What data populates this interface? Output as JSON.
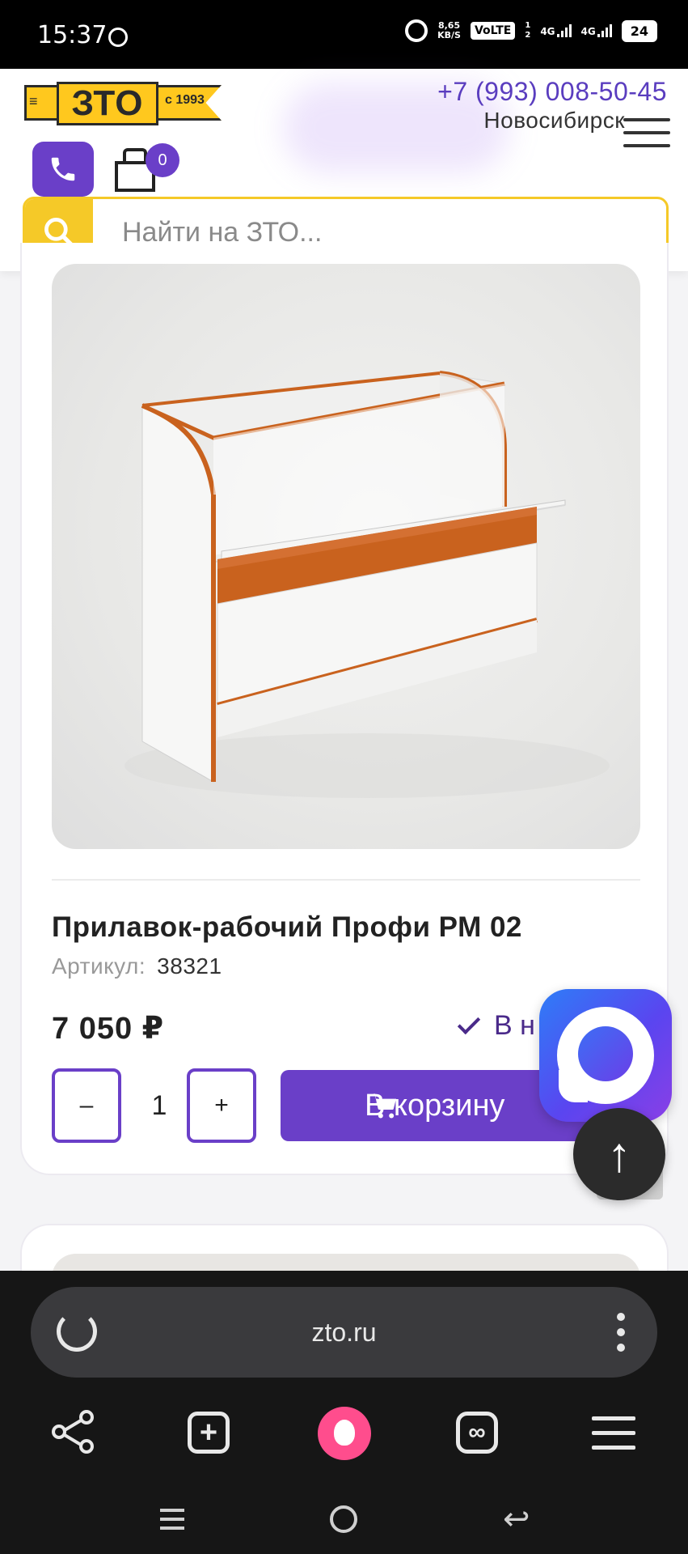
{
  "status_bar": {
    "time": "15:37",
    "speed_value": "8,65",
    "speed_unit": "KB/S",
    "volte": "VoLTE",
    "sim1": "1",
    "sim2": "2",
    "net1": "4G",
    "net2": "4G",
    "battery": "24"
  },
  "header": {
    "logo_mark": "≡",
    "logo_text": "ЗТО",
    "logo_year": "с 1993",
    "phone": "+7 (993) 008-50-45",
    "city": "Новосибирск",
    "cart_count": "0",
    "search_placeholder": "Найти на ЗТО..."
  },
  "product": {
    "title": "Прилавок-рабочий Профи РМ 02",
    "sku_label": "Артикул:",
    "sku_value": "38321",
    "price": "7 050 ₽",
    "stock": "В н",
    "qty_minus": "–",
    "qty_value": "1",
    "qty_plus": "+",
    "add_to_cart": "В корзину"
  },
  "floating": {
    "scroll_top": "↑"
  },
  "browser": {
    "url": "zto.ru",
    "tab_plus": "+",
    "tab_inf": "∞",
    "back": "↩"
  },
  "colors": {
    "accent": "#6a3fc8",
    "search_border": "#f5c928",
    "logo_yellow": "#ffc81e"
  }
}
